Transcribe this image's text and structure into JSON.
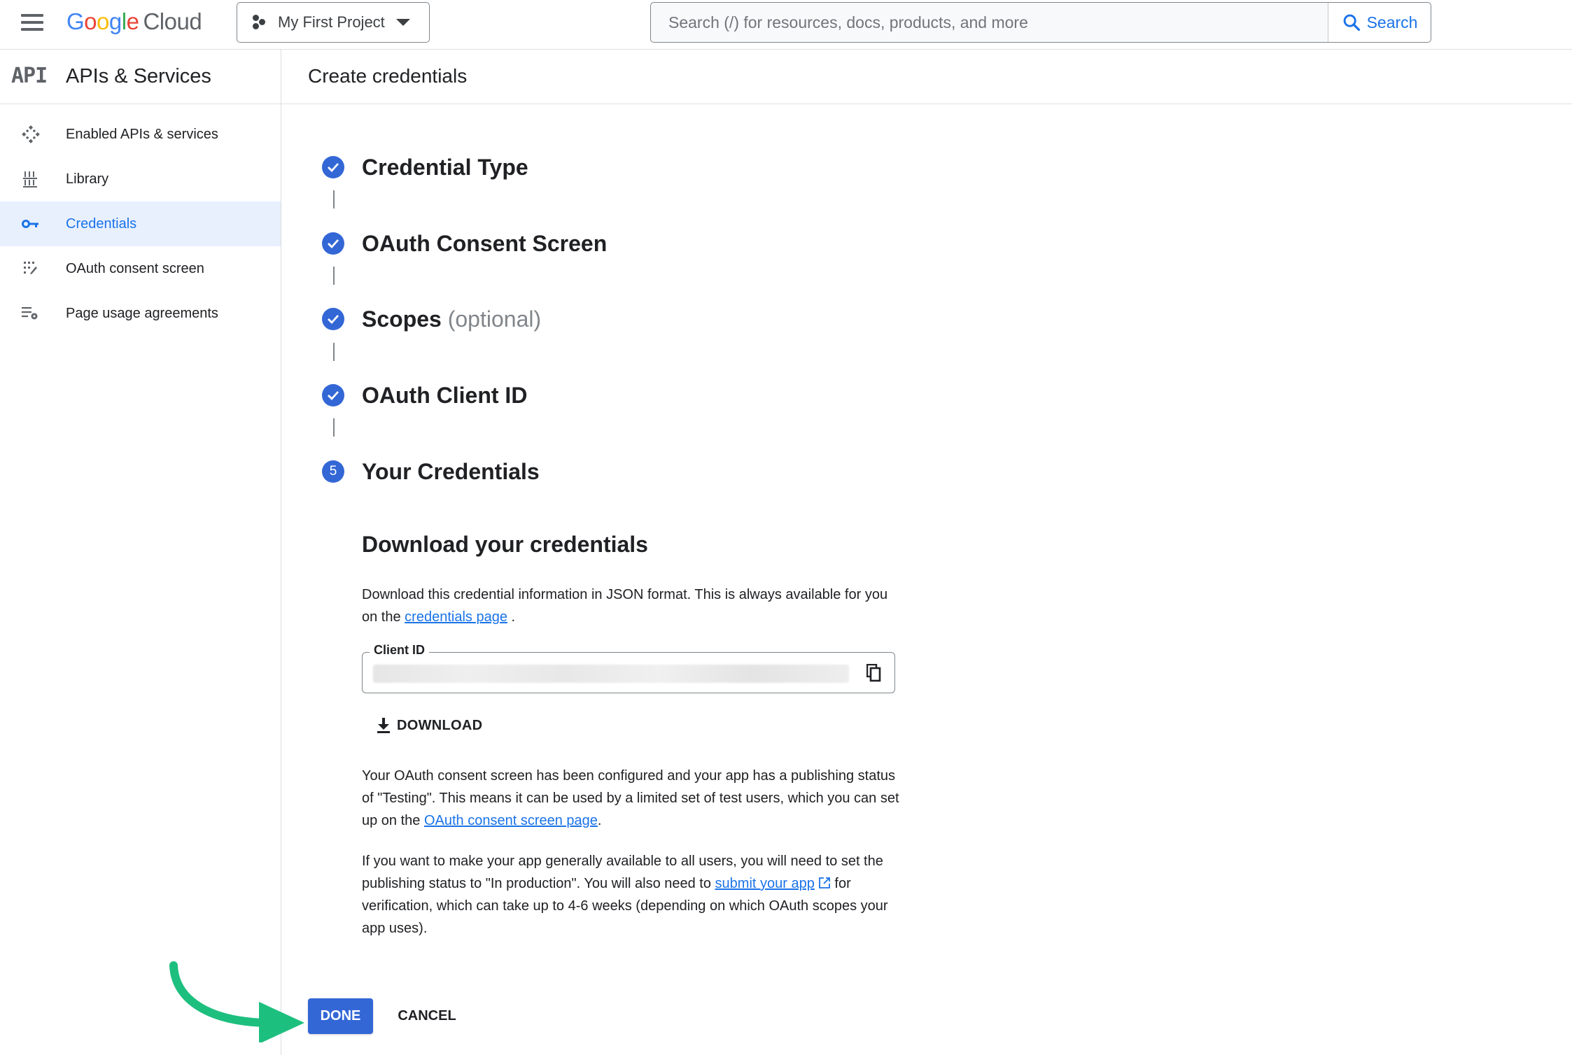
{
  "header": {
    "logo": {
      "google": "Google",
      "product": "Cloud"
    },
    "project": "My First Project",
    "search_placeholder": "Search (/) for resources, docs, products, and more",
    "search_button": "Search"
  },
  "subheader": {
    "api_badge": "API",
    "section_title": "APIs & Services",
    "page_title": "Create credentials"
  },
  "sidebar": {
    "items": [
      {
        "label": "Enabled APIs & services",
        "icon": "enabled-apis-icon",
        "active": false
      },
      {
        "label": "Library",
        "icon": "library-icon",
        "active": false
      },
      {
        "label": "Credentials",
        "icon": "key-icon",
        "active": true
      },
      {
        "label": "OAuth consent screen",
        "icon": "oauth-consent-icon",
        "active": false
      },
      {
        "label": "Page usage agreements",
        "icon": "settings-list-icon",
        "active": false
      }
    ]
  },
  "stepper": {
    "steps": [
      {
        "title": "Credential Type",
        "status": "complete"
      },
      {
        "title": "OAuth Consent Screen",
        "status": "complete"
      },
      {
        "title": "Scopes",
        "suffix": "(optional)",
        "status": "complete"
      },
      {
        "title": "OAuth Client ID",
        "status": "complete"
      },
      {
        "title": "Your Credentials",
        "number": "5",
        "status": "current"
      }
    ]
  },
  "content": {
    "heading": "Download your credentials",
    "intro_text": "Download this credential information in JSON format. This is always available for you on the ",
    "intro_link": "credentials page",
    "intro_end": " .",
    "client_id_label": "Client ID",
    "client_id_value": "",
    "download_label": "DOWNLOAD",
    "testing_text": "Your OAuth consent screen has been configured and your app has a publishing status of \"Testing\". This means it can be used by a limited set of test users, which you can set up on the ",
    "testing_link": "OAuth consent screen page",
    "testing_end": ".",
    "production_text": "If you want to make your app generally available to all users, you will need to set the publishing status to \"In production\". You will also need to ",
    "production_link": "submit your app",
    "production_end": " for verification, which can take up to 4-6 weeks (depending on which OAuth scopes your app uses)."
  },
  "actions": {
    "done": "DONE",
    "cancel": "CANCEL"
  },
  "colors": {
    "primary": "#3367d6",
    "link": "#1a73e8",
    "annotation_arrow": "#1dbf7e",
    "active_nav_bg": "#e8f0fe"
  }
}
